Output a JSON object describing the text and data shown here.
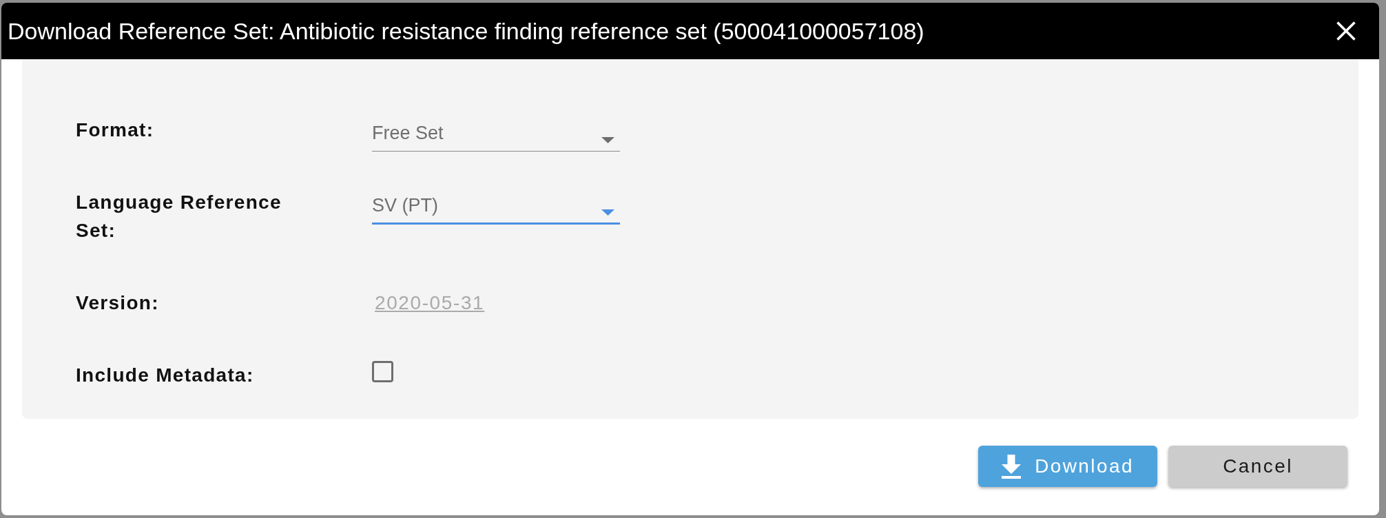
{
  "dialog": {
    "title": "Download Reference Set: Antibiotic resistance finding reference set (500041000057108)"
  },
  "form": {
    "fields": [
      {
        "kind": "select",
        "label": "Format:",
        "value": "Free Set",
        "focused": false
      },
      {
        "kind": "select",
        "label": "Language Reference Set:",
        "value": "SV (PT)",
        "focused": true
      },
      {
        "kind": "link",
        "label": "Version:",
        "value": "2020-05-31"
      },
      {
        "kind": "checkbox",
        "label": "Include Metadata:",
        "checked": false
      }
    ]
  },
  "buttons": [
    {
      "kind": "primary",
      "label": "Download"
    },
    {
      "kind": "secondary",
      "label": "Cancel"
    }
  ]
}
